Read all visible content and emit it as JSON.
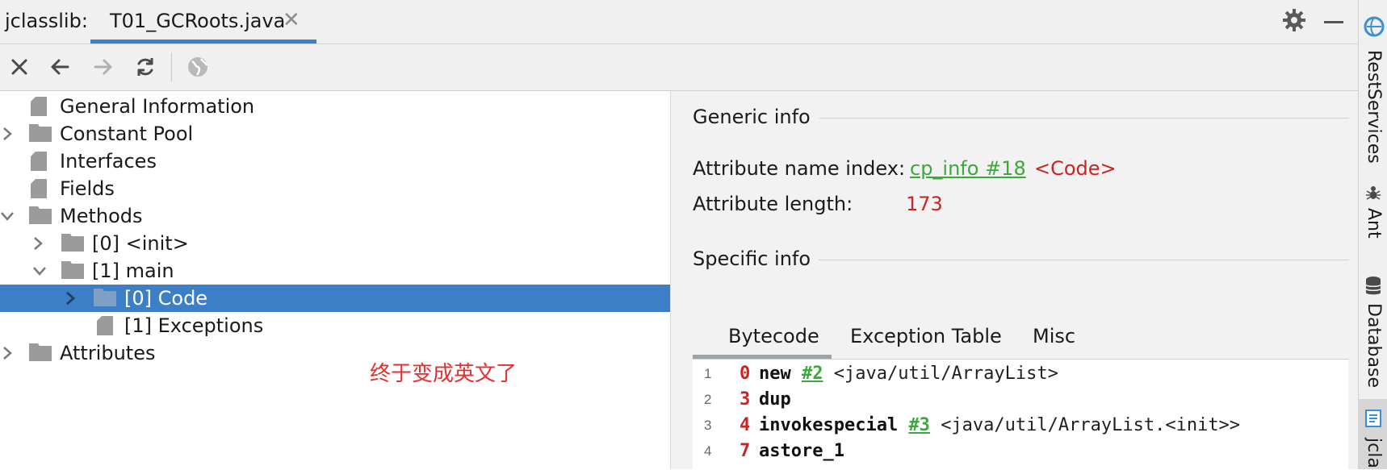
{
  "header": {
    "app_label": "jclasslib:",
    "tab_label": "T01_GCRoots.java",
    "tab_close": "✕"
  },
  "toolbar": {
    "buttons": [
      "close-icon",
      "back-arrow-icon",
      "forward-arrow-icon",
      "refresh-icon",
      "globe-icon"
    ]
  },
  "tree": {
    "items": [
      {
        "label": "General Information",
        "icon": "file-icon"
      },
      {
        "label": "Constant Pool",
        "icon": "folder-icon",
        "state": "collapsed"
      },
      {
        "label": "Interfaces",
        "icon": "file-icon"
      },
      {
        "label": "Fields",
        "icon": "file-icon"
      },
      {
        "label": "Methods",
        "icon": "folder-icon",
        "state": "expanded"
      },
      {
        "label": "[0] <init>",
        "icon": "folder-icon",
        "state": "collapsed"
      },
      {
        "label": "[1] main",
        "icon": "folder-icon",
        "state": "expanded"
      },
      {
        "label": "[0] Code",
        "icon": "folder-icon",
        "state": "collapsed",
        "selected": true
      },
      {
        "label": "[1] Exceptions",
        "icon": "file-icon"
      },
      {
        "label": "Attributes",
        "icon": "folder-icon",
        "state": "collapsed"
      }
    ],
    "note": "终于变成英文了"
  },
  "panel": {
    "generic_title": "Generic info",
    "attr_name_index_label": "Attribute name index:",
    "attr_name_index_link": "cp_info #18",
    "attr_name_index_value": "<Code>",
    "attr_length_label": "Attribute length:",
    "attr_length_value": "173",
    "specific_title": "Specific info",
    "tabs": [
      "Bytecode",
      "Exception Table",
      "Misc"
    ],
    "bytecode": [
      {
        "line": "1",
        "offset": "0",
        "op": "new",
        "ref": "#2",
        "comment": "<java/util/ArrayList>"
      },
      {
        "line": "2",
        "offset": "3",
        "op": "dup",
        "ref": "",
        "comment": ""
      },
      {
        "line": "3",
        "offset": "4",
        "op": "invokespecial",
        "ref": "#3",
        "comment": "<java/util/ArrayList.<init>>"
      },
      {
        "line": "4",
        "offset": "7",
        "op": "astore_1",
        "ref": "",
        "comment": ""
      }
    ]
  },
  "sidebar": {
    "items": [
      "RestServices",
      "Ant",
      "Database",
      "jcla"
    ]
  },
  "colors": {
    "accent": "#3d84c6",
    "selection": "#3d7fc7",
    "link_green": "#3ca83c",
    "value_red": "#cc2222"
  }
}
